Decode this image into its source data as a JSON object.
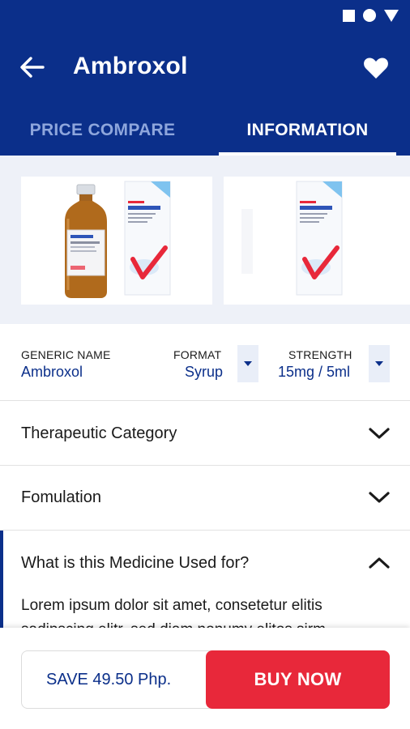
{
  "status_bar": {
    "icons": [
      "square-icon",
      "circle-icon",
      "triangle-icon"
    ]
  },
  "app_bar": {
    "title": "Ambroxol",
    "back_icon": "arrow-left-icon",
    "favorite_icon": "heart-icon"
  },
  "tabs": [
    {
      "label": "PRICE COMPARE",
      "active": false
    },
    {
      "label": "INFORMATION",
      "active": true
    }
  ],
  "gallery": {
    "images": [
      "syrup-bottle-and-box-image",
      "syrup-box-image"
    ]
  },
  "details": {
    "generic_name": {
      "label": "GENERIC NAME",
      "value": "Ambroxol"
    },
    "format": {
      "label": "FORMAT",
      "value": "Syrup"
    },
    "strength": {
      "label": "STRENGTH",
      "value": "15mg / 5ml"
    }
  },
  "sections": [
    {
      "title": "Therapeutic Category",
      "expanded": false
    },
    {
      "title": "Fomulation",
      "expanded": false
    },
    {
      "title": "What is this Medicine Used for?",
      "expanded": true,
      "body_lines": [
        "Lorem ipsum dolor sit amet, consetetur elitis",
        "sadipscing elitr, sed diam nonumy elitos sirm"
      ]
    }
  ],
  "footer": {
    "save_text": "SAVE 49.50 Php.",
    "buy_label": "BUY NOW"
  },
  "colors": {
    "primary": "#0b2f8a",
    "accent": "#e8283a",
    "tab_inactive": "#8ea6dc"
  }
}
